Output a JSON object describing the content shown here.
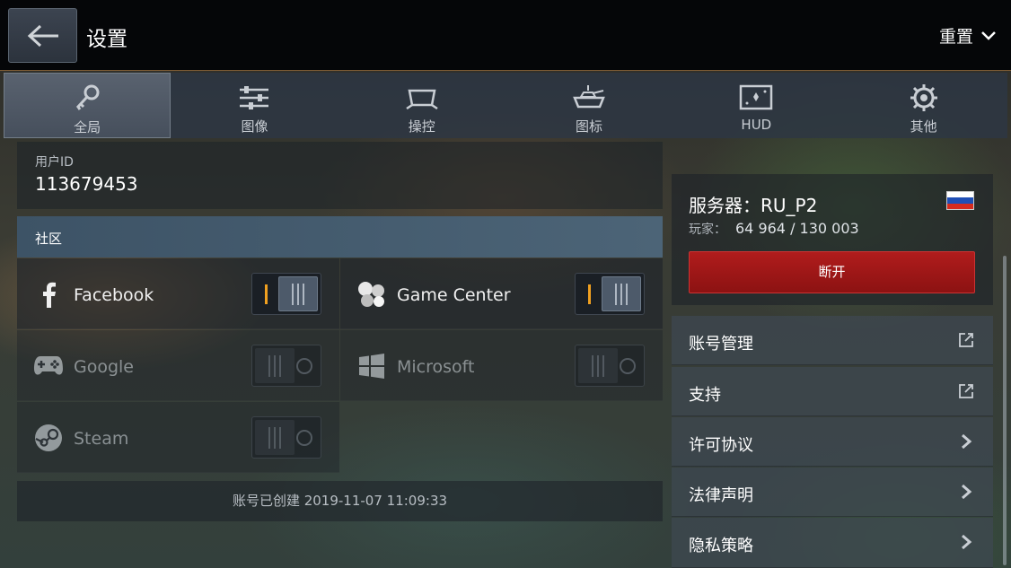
{
  "header": {
    "title": "设置",
    "reset_label": "重置"
  },
  "tabs": [
    {
      "label": "全局",
      "icon": "key-icon",
      "active": true
    },
    {
      "label": "图像",
      "icon": "sliders-icon"
    },
    {
      "label": "操控",
      "icon": "controls-icon"
    },
    {
      "label": "图标",
      "icon": "tank-icon"
    },
    {
      "label": "HUD",
      "icon": "hud-icon"
    },
    {
      "label": "其他",
      "icon": "gear-icon"
    }
  ],
  "user": {
    "id_caption": "用户ID",
    "id_value": "113679453"
  },
  "community": {
    "title": "社区",
    "accounts": [
      {
        "name": "Facebook",
        "icon": "facebook-icon",
        "linked": true
      },
      {
        "name": "Game Center",
        "icon": "game-center-icon",
        "linked": true
      },
      {
        "name": "Google",
        "icon": "gamepad-icon",
        "linked": false
      },
      {
        "name": "Microsoft",
        "icon": "windows-icon",
        "linked": false
      },
      {
        "name": "Steam",
        "icon": "steam-icon",
        "linked": false
      }
    ],
    "created_text": "账号已创建 2019-11-07 11:09:33"
  },
  "server": {
    "label": "服务器：RU_P2",
    "players_caption": "玩家：",
    "players_value": "64 964 / 130 003",
    "flag": "russia-flag",
    "disconnect_label": "断开"
  },
  "menu": [
    {
      "label": "账号管理",
      "icon": "external-link-icon"
    },
    {
      "label": "支持",
      "icon": "external-link-icon"
    },
    {
      "label": "许可协议",
      "icon": "chevron-right-icon"
    },
    {
      "label": "法律声明",
      "icon": "chevron-right-icon"
    },
    {
      "label": "隐私策略",
      "icon": "chevron-right-icon"
    }
  ],
  "colors": {
    "accent_orange": "#f0a020",
    "disconnect_red": "#a51818",
    "active_tab": "#59626f"
  }
}
